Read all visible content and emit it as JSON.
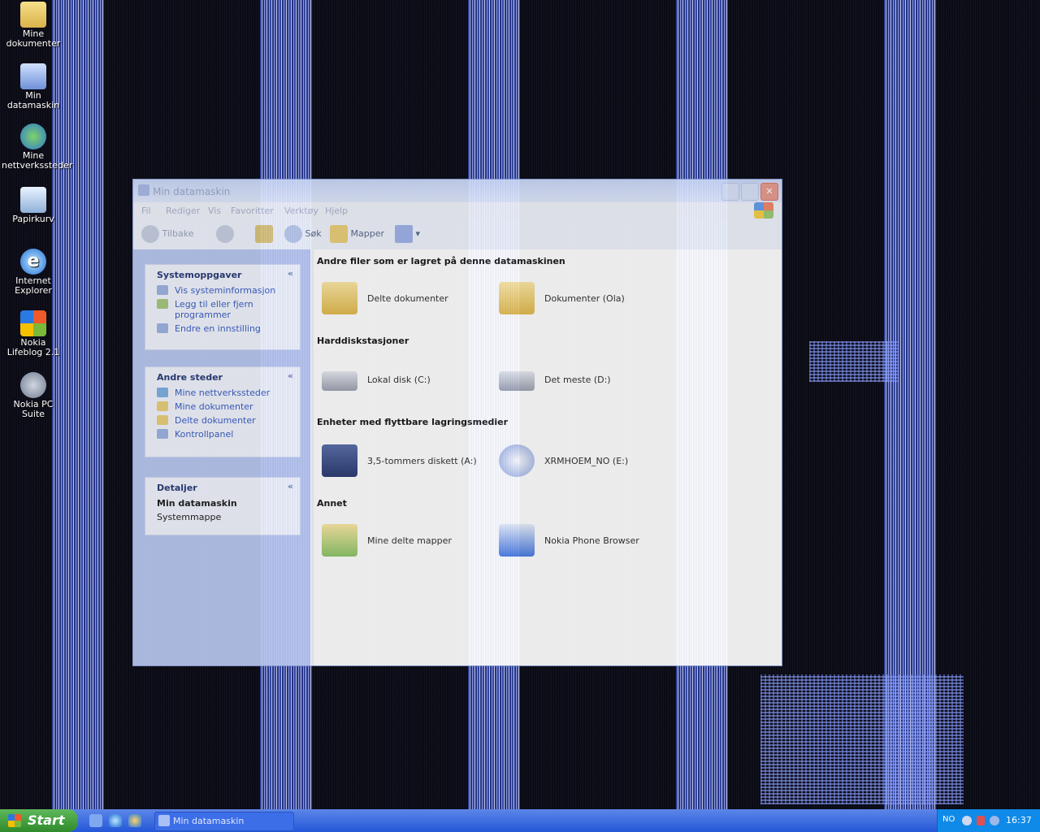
{
  "desktop": {
    "icons": [
      {
        "label": "Mine dokumenter",
        "icon": "my-documents-icon"
      },
      {
        "label": "Min datamaskin",
        "icon": "my-computer-icon"
      },
      {
        "label": "Mine nettverkssteder",
        "icon": "network-places-icon"
      },
      {
        "label": "Papirkurv",
        "icon": "recycle-bin-icon"
      },
      {
        "label": "Internet Explorer",
        "icon": "internet-explorer-icon"
      },
      {
        "label": "Nokia Lifeblog 2.1",
        "icon": "nokia-lifeblog-icon"
      },
      {
        "label": "Nokia PC Suite",
        "icon": "nokia-pc-suite-icon"
      }
    ]
  },
  "window": {
    "title": "Min datamaskin",
    "menu": [
      "Fil",
      "Rediger",
      "Vis",
      "Favoritter",
      "Verktøy",
      "Hjelp"
    ],
    "toolbar": {
      "back": "Tilbake",
      "search": "Søk",
      "folders": "Mapper"
    },
    "panels": {
      "system": {
        "title": "Systemoppgaver",
        "items": [
          "Vis systeminformasjon",
          "Legg til eller fjern programmer",
          "Endre en innstilling"
        ]
      },
      "other": {
        "title": "Andre steder",
        "items": [
          "Mine nettverkssteder",
          "Mine dokumenter",
          "Delte dokumenter",
          "Kontrollpanel"
        ]
      },
      "details": {
        "title": "Detaljer",
        "name": "Min datamaskin",
        "type": "Systemmappe"
      }
    },
    "sections": [
      {
        "heading": "Andre filer som er lagret på denne datamaskinen",
        "items": [
          "Delte dokumenter",
          "Dokumenter (Ola)"
        ]
      },
      {
        "heading": "Harddiskstasjoner",
        "items": [
          "Lokal disk (C:)",
          "Det meste (D:)"
        ]
      },
      {
        "heading": "Enheter med flyttbare lagringsmedier",
        "items": [
          "3,5-tommers diskett (A:)",
          "XRMHOEM_NO (E:)"
        ]
      },
      {
        "heading": "Annet",
        "items": [
          "Mine delte mapper",
          "Nokia Phone Browser"
        ]
      }
    ]
  },
  "taskbar": {
    "start": "Start",
    "task": "Min datamaskin",
    "lang": "NO",
    "clock": "16:37"
  }
}
